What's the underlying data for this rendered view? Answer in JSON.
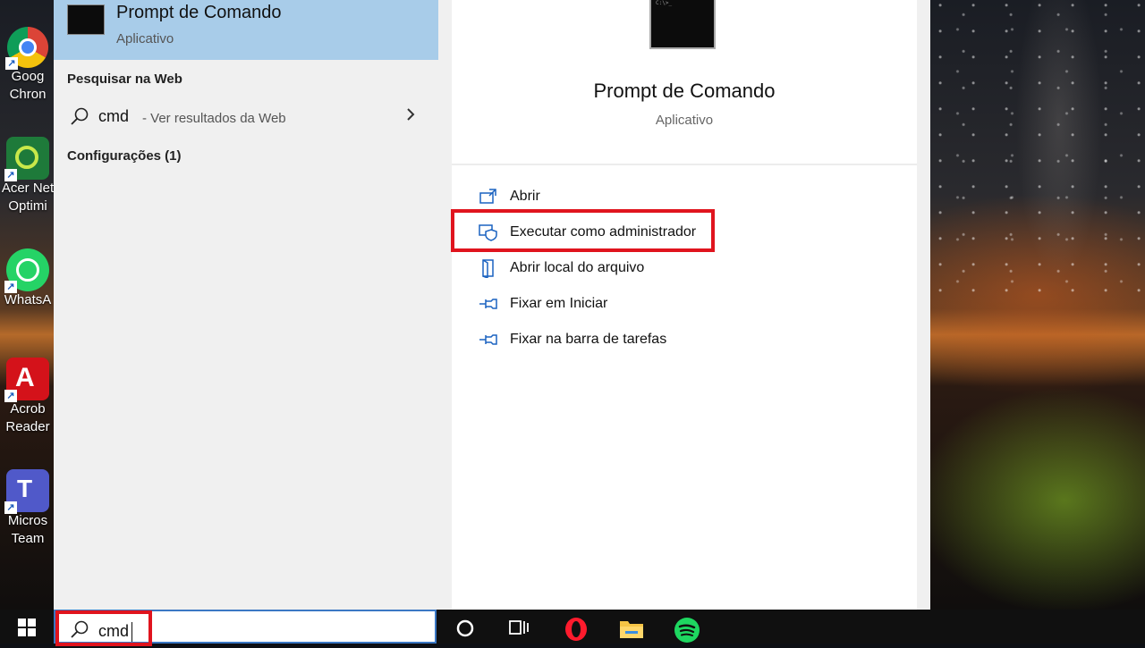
{
  "desktop": {
    "icons": [
      {
        "label": "Google Chrome",
        "line1": "Goog",
        "line2": "Chron"
      },
      {
        "label": "Acer Network Optimizer",
        "line1": "Acer Net",
        "line2": "Optimi"
      },
      {
        "label": "WhatsApp",
        "line1": "WhatsA",
        "line2": ""
      },
      {
        "label": "Acrobat Reader",
        "line1": "Acrob",
        "line2": "Reader"
      },
      {
        "label": "Microsoft Teams",
        "line1": "Micros",
        "line2": "Team"
      }
    ]
  },
  "search_results": {
    "best_match": {
      "name": "Prompt de Comando",
      "type": "Aplicativo"
    },
    "web_section_title": "Pesquisar na Web",
    "web_query": "cmd",
    "web_hint": "- Ver resultados da Web",
    "settings_section_title": "Configurações (1)"
  },
  "preview": {
    "thumb_text": "C:\\>_",
    "name": "Prompt de Comando",
    "type": "Aplicativo",
    "actions": [
      {
        "label": "Abrir",
        "icon": "open-window-icon"
      },
      {
        "label": "Executar como administrador",
        "icon": "shield-admin-icon"
      },
      {
        "label": "Abrir local do arquivo",
        "icon": "file-location-icon"
      },
      {
        "label": "Fixar em Iniciar",
        "icon": "pin-icon"
      },
      {
        "label": "Fixar na barra de tarefas",
        "icon": "pin-icon"
      }
    ]
  },
  "taskbar": {
    "search_value": "cmd",
    "icons": [
      "windows-start-icon",
      "cortana-icon",
      "task-view-icon",
      "opera-icon",
      "file-explorer-icon",
      "spotify-icon"
    ]
  },
  "colors": {
    "highlight_red": "#e0141e",
    "selected_blue": "#a8cce9",
    "accent_blue": "#3b78c4"
  }
}
